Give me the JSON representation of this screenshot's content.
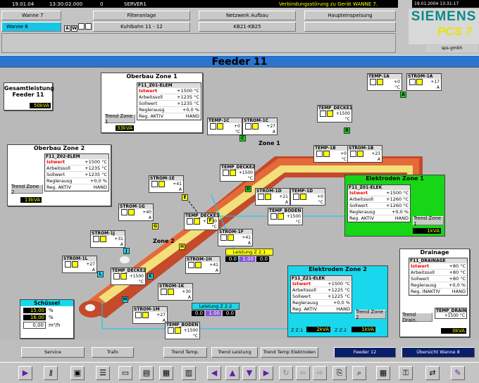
{
  "status": {
    "date": "19.01.04",
    "time": "13:30:02.000",
    "count": "0",
    "server": "SERVER1",
    "message": "Verbindungsstörung zu Gerät WANNE 7.",
    "datetime": "19.01.2004 13:31:17"
  },
  "areas": {
    "wanne7": "Wanne 7",
    "wanne8": "Wanne 8",
    "row1": [
      "Filteranlage",
      "Netzwerk Aufbau",
      "Haupteinspeisung"
    ],
    "row2": [
      "Kuhlbahn 11 - 12",
      "KB21-KB25",
      ""
    ]
  },
  "brand": {
    "name": "SIEMENS",
    "product": "PCS 7",
    "company": "sps-gmbh"
  },
  "page_title": "Feeder 11",
  "gesamt": {
    "title": "Gesamtleistung Feeder 11",
    "value": "50kVA"
  },
  "panels": {
    "ob1": {
      "title": "Oberbau Zone 1",
      "tag": "F11_Z01-ELEM",
      "rows": [
        [
          "Istwert",
          "+1500",
          "°C"
        ],
        [
          "Arbeitssoll",
          "+1235",
          "°C"
        ],
        [
          "Sollwert",
          "+1235",
          "°C"
        ],
        [
          "Reglerausg",
          "+0,0",
          "%"
        ],
        [
          "Reg. AKTIV",
          "HAND",
          ""
        ]
      ],
      "trend": "Trend Zone 1",
      "kva": "33kVA"
    },
    "ob2": {
      "title": "Oberbau Zone 2",
      "tag": "F11_Z02-ELEM",
      "rows": [
        [
          "Istwert",
          "+1500",
          "°C"
        ],
        [
          "Arbeitssoll",
          "+1235",
          "°C"
        ],
        [
          "Sollwert",
          "+1235",
          "°C"
        ],
        [
          "Reglerausg",
          "+0,0",
          "%"
        ],
        [
          "Reg. AKTIV",
          "HAND",
          ""
        ]
      ],
      "trend": "Trend Zone 2",
      "kva": "13kVA"
    },
    "el1": {
      "title": "Elektroden Zone 1",
      "tag": "F11_Z01-ELEK",
      "rows": [
        [
          "Istwert",
          "+1500",
          "°C"
        ],
        [
          "Arbeitssoll",
          "+1260",
          "°C"
        ],
        [
          "Sollwert",
          "+1260",
          "°C"
        ],
        [
          "Reglerausg",
          "+0,0",
          "%"
        ],
        [
          "Reg. AKTIV",
          "HAND",
          ""
        ]
      ],
      "trend": "Trend Zone 1",
      "kva": "1kVA"
    },
    "el2": {
      "title": "Elektroden Zone 2",
      "tag": "F11_Z21-ELEK",
      "rows": [
        [
          "Istwert",
          "+1500",
          "°C"
        ],
        [
          "Arbeitssoll",
          "+1225",
          "°C"
        ],
        [
          "Sollwert",
          "+1225",
          "°C"
        ],
        [
          "Reglerausg",
          "+0,0",
          "%"
        ],
        [
          "Reg. AKTIV",
          "HAND",
          ""
        ]
      ],
      "trend": "Trend Zone 2",
      "zl1": "Z Z.1",
      "kva1": "2kVA",
      "zl2": "Z Z.2",
      "kva2": "1kVA"
    },
    "drain": {
      "title": "Drainage",
      "tag": "F11_DRAINAGE",
      "rows": [
        [
          "Istwert",
          "+80",
          "°C"
        ],
        [
          "Arbeitssoll",
          "+80",
          "°C"
        ],
        [
          "Sollwert",
          "+80",
          "°C"
        ],
        [
          "Reglerausg",
          "+0,0",
          "%"
        ],
        [
          "Reg. INAKTIV",
          "HAND",
          ""
        ]
      ],
      "trend": "Trend Drain.",
      "temptag": "TEMP_DRAIN",
      "tempval": "+1500",
      "tempunit": "°C",
      "kva": "0kVA"
    }
  },
  "schussel": {
    "title": "Schüssel",
    "rows": [
      [
        "15,00",
        "%"
      ],
      [
        "16,00",
        "%"
      ],
      [
        "0,00",
        "m³/h"
      ]
    ]
  },
  "zones": {
    "z1": "Zone 1",
    "z2": "Zone 2"
  },
  "tags": [
    {
      "n": "TEMP-1A",
      "v": "+0",
      "u": "°C"
    },
    {
      "n": "STROM-1A",
      "v": "+17",
      "u": "A"
    },
    {
      "n": "TEMP_DECKE1",
      "v": "+1500",
      "u": "°C"
    },
    {
      "n": "TEMP-1B",
      "v": "+0",
      "u": "°C"
    },
    {
      "n": "STROM-1B",
      "v": "+23",
      "u": "A"
    },
    {
      "n": "TEMP-1C",
      "v": "+0",
      "u": "°C"
    },
    {
      "n": "STROM-1C",
      "v": "+27",
      "u": "A"
    },
    {
      "n": "TEMP_DECKE2",
      "v": "+1500",
      "u": "°C"
    },
    {
      "n": "STROM-1D",
      "v": "+21",
      "u": "A"
    },
    {
      "n": "TEMP-1D",
      "v": "+0",
      "u": "°C"
    },
    {
      "n": "STROM-1E",
      "v": "+41",
      "u": "A"
    },
    {
      "n": "TEMP_BODEN",
      "v": "+1500",
      "u": "°C"
    },
    {
      "n": "STROM-1G",
      "v": "+40",
      "u": "A"
    },
    {
      "n": "TEMP_DECKE1",
      "v": "+1500",
      "u": "°C"
    },
    {
      "n": "STROM-1F",
      "v": "+41",
      "u": "A"
    },
    {
      "n": "STROM-1J",
      "v": "+31",
      "u": "A"
    },
    {
      "n": "STROM-1L",
      "v": "+27",
      "u": "A"
    },
    {
      "n": "STROM-1H",
      "v": "+41",
      "u": "A"
    },
    {
      "n": "TEMP_DECKE2",
      "v": "+1500",
      "u": "°C"
    },
    {
      "n": "STROM-1K",
      "v": "+30",
      "u": "A"
    },
    {
      "n": "STROM-1M",
      "v": "+27",
      "u": "A"
    },
    {
      "n": "TEMP_BODEN",
      "v": "+1500",
      "u": "°C"
    }
  ],
  "markers": [
    "A",
    "B",
    "C",
    "D",
    "E",
    "F",
    "G",
    "H",
    "J",
    "K",
    "L",
    "M"
  ],
  "leistung1": {
    "title": "Leistung Z 2.1",
    "v1": "0.0",
    "v2": "1.00",
    "v3": "0.0"
  },
  "leistung2": {
    "title": "Leistung Z 2.2",
    "v1": "0.0",
    "v2": "1.00",
    "v3": "0.0"
  },
  "buttons": [
    "Service",
    "Trafo",
    "Trend Temp.",
    "Trend Leistung",
    "Trend Temp Elektroden",
    "Feeder 12",
    "Übersicht Wanne 8"
  ]
}
